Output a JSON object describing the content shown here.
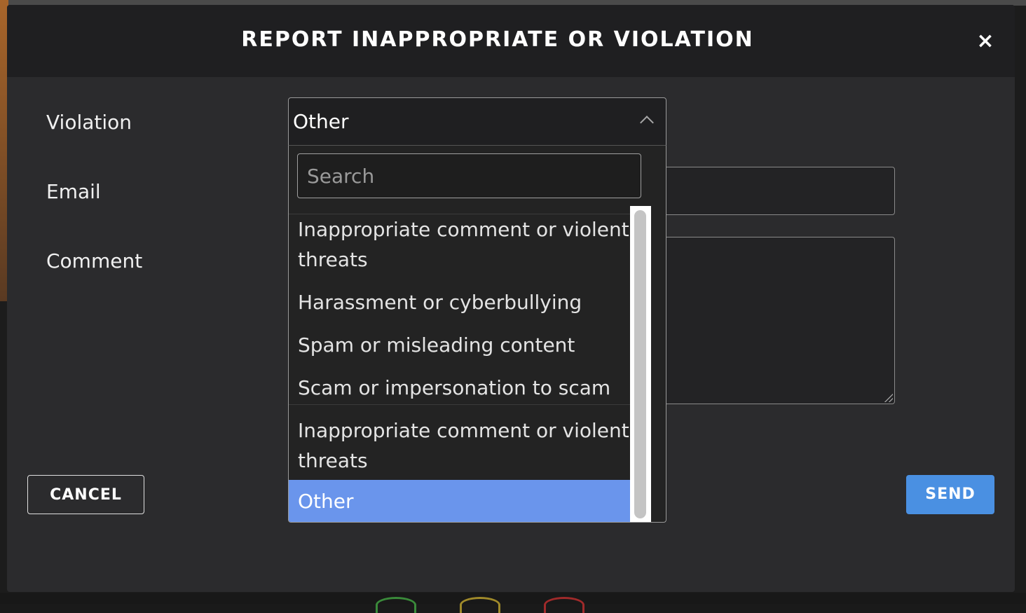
{
  "dialog": {
    "title": "REPORT INAPPROPRIATE OR VIOLATION",
    "close_icon": "×"
  },
  "form": {
    "violation_label": "Violation",
    "email_label": "Email",
    "comment_label": "Comment",
    "violation_selected": "Other"
  },
  "dropdown": {
    "search_placeholder": "Search",
    "options": [
      {
        "label": "Inappropriate comment or violent threats"
      },
      {
        "label": "Harassment or cyberbullying"
      },
      {
        "label": "Spam or misleading content"
      },
      {
        "label": "Scam or impersonation to scam"
      },
      {
        "label": "Inappropriate comment or violent threats"
      },
      {
        "label": "Other",
        "selected": true
      }
    ]
  },
  "buttons": {
    "cancel_label": "CANCEL",
    "send_label": "SEND"
  },
  "colors": {
    "accent": "#4a90e2",
    "selected_option": "#6a95ec",
    "modal_bg": "#2b2b2d",
    "header_bg": "#1f1f21"
  }
}
